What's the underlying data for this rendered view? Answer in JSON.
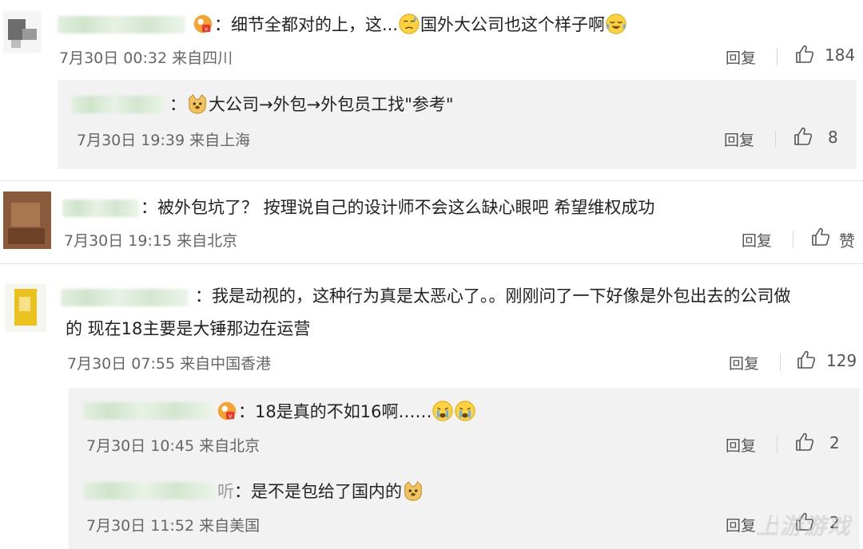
{
  "comments": [
    {
      "text": "：细节全都对的上，这...",
      "text2": "国外大公司也这个样子啊",
      "meta": "7月30日 00:32 来自四川",
      "reply": "回复",
      "likes": "184",
      "replies": [
        {
          "text": "：",
          "text2": "大公司→外包→外包员工找\"参考\"",
          "meta": "7月30日 19:39 来自上海",
          "reply": "回复",
          "likes": "8"
        }
      ]
    },
    {
      "text": "：被外包坑了？ 按理说自己的设计师不会这么缺心眼吧 希望维权成功",
      "meta": "7月30日 19:15 来自北京",
      "reply": "回复",
      "likes": "赞"
    },
    {
      "text": "：我是动视的，这种行为真是太恶心了。。刚刚问了一下好像是外包出去的公司做",
      "text_line2": "的 现在18主要是大锤那边在运营",
      "meta": "7月30日 07:55 来自中国香港",
      "reply": "回复",
      "likes": "129",
      "replies": [
        {
          "text": "：18是真的不如16啊……",
          "meta": "7月30日 10:45 来自北京",
          "reply": "回复",
          "likes": "2"
        },
        {
          "name_suffix": "听",
          "text": "：是不是包给了国内的",
          "meta": "7月30日 11:52 来自美国",
          "reply": "回复",
          "likes": "2"
        }
      ]
    }
  ],
  "icons": {
    "like": "thumbs-up-icon",
    "badge": "user-badge-icon",
    "emoji_sweat": "sweat-face-emoji",
    "emoji_cry": "laugh-cry-emoji",
    "emoji_doge": "doge-emoji",
    "emoji_tears": "tears-face-emoji"
  },
  "watermark": "上游游戏",
  "colors": {
    "background": "#ffffff",
    "reply_box": "#f2f2f2",
    "meta_text": "#666666",
    "name_blur": "#cfe5cb"
  }
}
